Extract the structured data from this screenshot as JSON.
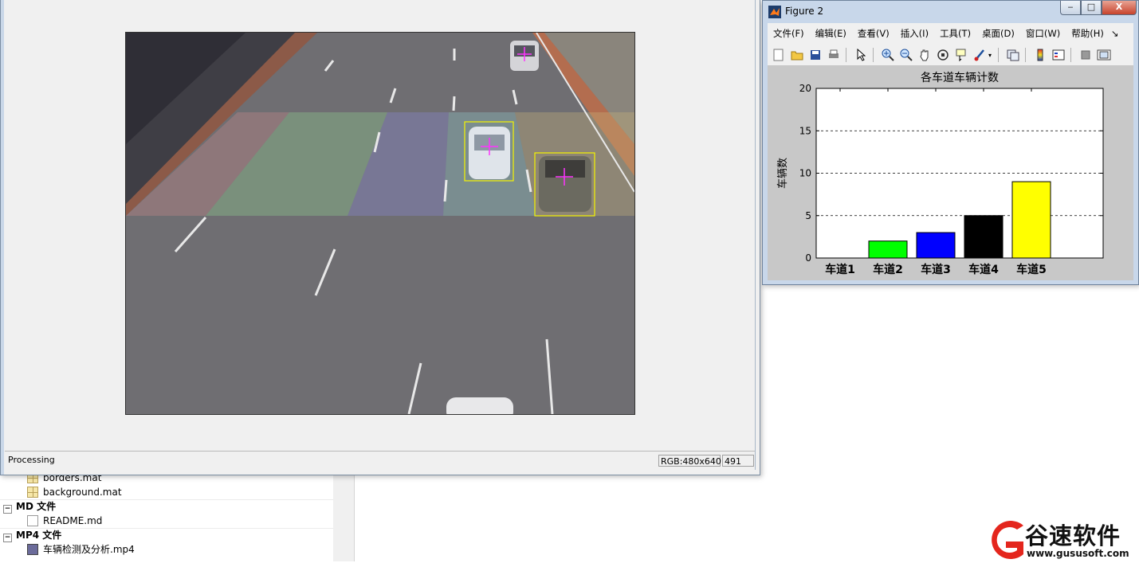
{
  "file_browser": {
    "items_top": [
      {
        "name": "borders.mat",
        "icon": "mat-file-icon"
      },
      {
        "name": "background.mat",
        "icon": "mat-file-icon"
      }
    ],
    "groups": [
      {
        "label": "MD 文件",
        "files": [
          {
            "name": "README.md",
            "icon": "md-file-icon"
          }
        ]
      },
      {
        "label": "MP4 文件",
        "files": [
          {
            "name": "车辆检测及分析.mp4",
            "icon": "video-file-icon"
          }
        ]
      }
    ]
  },
  "figure1": {
    "status_text": "Processing",
    "status_rgb": "RGB:480x640",
    "status_frame": "491",
    "lane_colors": [
      "#c98a8a",
      "#8fd08f",
      "#8a8ad8",
      "#8fc8c8",
      "#c8b47a"
    ]
  },
  "figure2": {
    "title": "Figure 2",
    "window_buttons": {
      "minimize": "‒",
      "maximize": "□",
      "close": "X"
    },
    "menu": [
      "文件(F)",
      "编辑(E)",
      "查看(V)",
      "插入(I)",
      "工具(T)",
      "桌面(D)",
      "窗口(W)",
      "帮助(H)"
    ],
    "toolbar_icons": [
      "new-figure-icon",
      "open-file-icon",
      "save-icon",
      "print-icon",
      "pointer-icon",
      "zoom-in-icon",
      "zoom-out-icon",
      "pan-icon",
      "rotate-icon",
      "data-cursor-icon",
      "brush-icon",
      "link-icon",
      "colorbar-icon",
      "legend-icon",
      "hide-plot-tools-icon",
      "show-plot-tools-icon"
    ]
  },
  "chart_data": {
    "type": "bar",
    "title": "各车道车辆计数",
    "xlabel": "",
    "ylabel": "车辆数",
    "categories": [
      "车道1",
      "车道2",
      "车道3",
      "车道4",
      "车道5"
    ],
    "values": [
      0,
      2,
      3,
      5,
      9
    ],
    "colors": [
      "#ffffff",
      "#00ff00",
      "#0000ff",
      "#000000",
      "#ffff00"
    ],
    "ylim": [
      0,
      20
    ],
    "yticks": [
      0,
      5,
      10,
      15,
      20
    ],
    "grid": "horizontal-dashed"
  },
  "watermark": {
    "brand": "谷速软件",
    "url": "www.gususoft.com"
  }
}
